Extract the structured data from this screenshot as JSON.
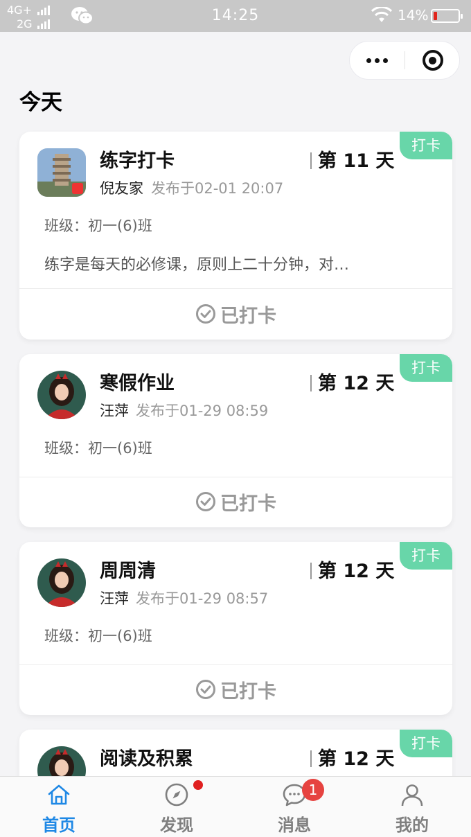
{
  "status_bar": {
    "network_top": "4G+",
    "network_bottom": "2G",
    "time": "14:25",
    "battery": "14%"
  },
  "header": {
    "section_title": "今天",
    "more_icon": "more-dots-icon",
    "close_icon": "target-close-icon"
  },
  "colors": {
    "tag_green": "#68d6a9",
    "active_blue": "#1e88e5",
    "badge_red": "#e64340"
  },
  "cards": [
    {
      "tag": "打卡",
      "title": "练字打卡",
      "day": "第 11 天",
      "author": "倪友家",
      "time": "发布于02-01 20:07",
      "class": "班级：初一(6)班",
      "desc": "练字是每天的必修课，原则上二十分钟，对…",
      "checked_label": "已打卡"
    },
    {
      "tag": "打卡",
      "title": "寒假作业",
      "day": "第 12 天",
      "author": "汪萍",
      "time": "发布于01-29 08:59",
      "class": "班级：初一(6)班",
      "checked_label": "已打卡"
    },
    {
      "tag": "打卡",
      "title": "周周清",
      "day": "第 12 天",
      "author": "汪萍",
      "time": "发布于01-29 08:57",
      "class": "班级：初一(6)班",
      "checked_label": "已打卡"
    },
    {
      "tag": "打卡",
      "title": "阅读及积累",
      "day": "第 12 天"
    }
  ],
  "tabbar": {
    "items": [
      {
        "label": "首页",
        "icon": "home-icon",
        "active": true
      },
      {
        "label": "发现",
        "icon": "compass-icon",
        "dot": true
      },
      {
        "label": "消息",
        "icon": "chat-icon",
        "badge": "1"
      },
      {
        "label": "我的",
        "icon": "user-icon"
      }
    ]
  }
}
